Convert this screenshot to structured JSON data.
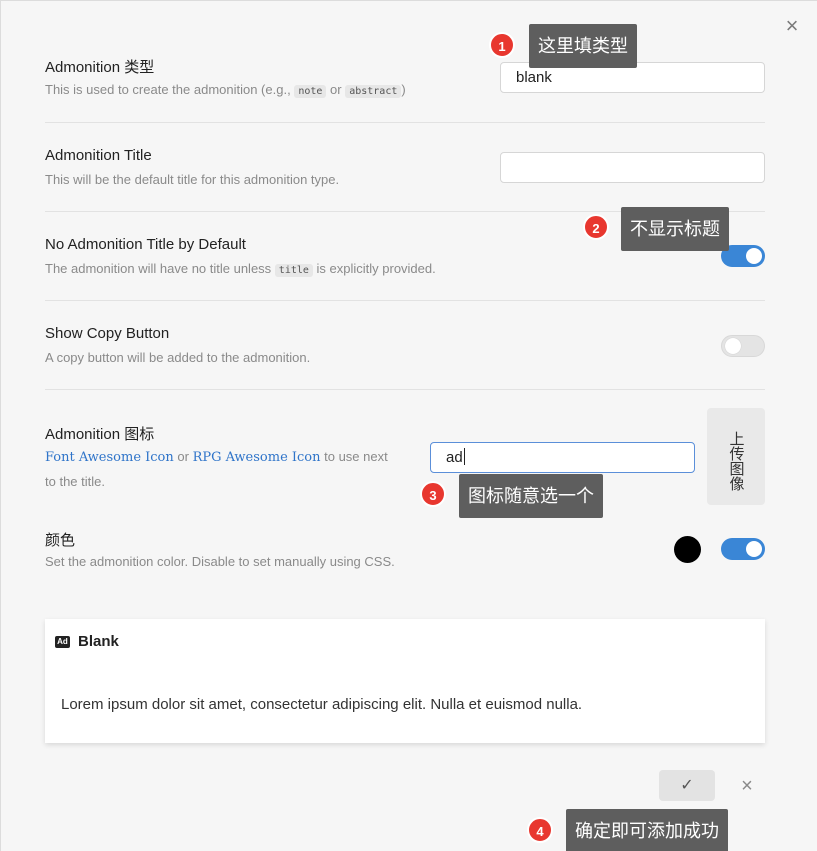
{
  "modal": {
    "close_icon": "×"
  },
  "settings": {
    "type": {
      "name": "Admonition 类型",
      "desc_prefix": "This is used to create the admonition (e.g., ",
      "code_note": "note",
      "desc_or": " or ",
      "code_abstract": "abstract",
      "desc_suffix": ")",
      "value": "blank"
    },
    "title": {
      "name": "Admonition Title",
      "desc": "This will be the default title for this admonition type.",
      "value": ""
    },
    "no_title": {
      "name": "No Admonition Title by Default",
      "desc_prefix": "The admonition will have no title unless ",
      "code_title": "title",
      "desc_suffix": " is explicitly provided.",
      "enabled": true
    },
    "copy_button": {
      "name": "Show Copy Button",
      "desc": "A copy button will be added to the admonition.",
      "enabled": false
    },
    "icon": {
      "name": "Admonition 图标",
      "link_fa": "Font Awesome Icon",
      "desc_or": " or ",
      "link_rpg": "RPG Awesome Icon",
      "desc_suffix": " to use next to the title.",
      "value": "ad",
      "upload_label": "上传图像"
    },
    "color": {
      "name": "颜色",
      "desc": "Set the admonition color. Disable to set manually using CSS.",
      "swatch": "#000000",
      "enabled": true
    }
  },
  "preview": {
    "icon_label": "Ad",
    "title": "Blank",
    "body": "Lorem ipsum dolor sit amet, consectetur adipiscing elit. Nulla et euismod nulla."
  },
  "actions": {
    "confirm_icon": "✓",
    "cancel_icon": "×"
  },
  "annotations": [
    {
      "number": "1",
      "text": "这里填类型"
    },
    {
      "number": "2",
      "text": "不显示标题"
    },
    {
      "number": "3",
      "text": "图标随意选一个"
    },
    {
      "number": "4",
      "text": "确定即可添加成功"
    }
  ],
  "colors": {
    "accent": "#3a86d6",
    "badge": "#e8372f",
    "callout": "#5e5e5e"
  }
}
